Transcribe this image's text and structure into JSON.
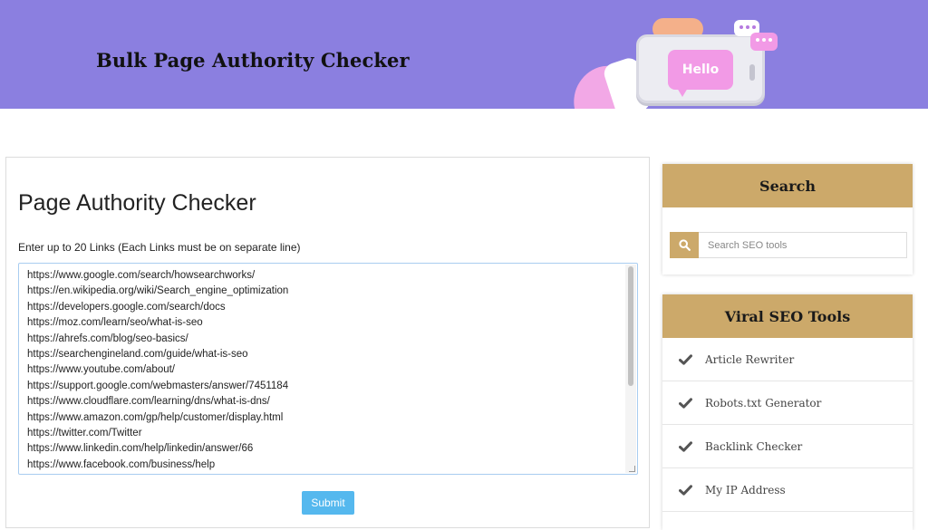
{
  "header": {
    "site_title": "Bulk Page Authority Checker",
    "hero_text": "Hello",
    "bg_color": "#8b7fe0"
  },
  "main": {
    "title": "Page Authority Checker",
    "instructions": "Enter up to 20 Links (Each Links must be on separate line)",
    "links": [
      "https://www.google.com/search/howsearchworks/",
      "https://en.wikipedia.org/wiki/Search_engine_optimization",
      "https://developers.google.com/search/docs",
      "https://moz.com/learn/seo/what-is-seo",
      "https://ahrefs.com/blog/seo-basics/",
      "https://searchengineland.com/guide/what-is-seo",
      "https://www.youtube.com/about/",
      "https://support.google.com/webmasters/answer/7451184",
      "https://www.cloudflare.com/learning/dns/what-is-dns/",
      "https://www.amazon.com/gp/help/customer/display.html",
      "https://twitter.com/Twitter",
      "https://www.linkedin.com/help/linkedin/answer/66",
      "https://www.facebook.com/business/help"
    ],
    "submit_label": "Submit",
    "submit_color": "#55b8ee"
  },
  "sidebar": {
    "accent_color": "#cca96a",
    "search": {
      "title": "Search",
      "placeholder": "Search SEO tools",
      "icon": "search-icon"
    },
    "tools": {
      "title": "Viral SEO Tools",
      "icon": "check-icon",
      "items": [
        {
          "label": "Article Rewriter"
        },
        {
          "label": "Robots.txt Generator"
        },
        {
          "label": "Backlink Checker"
        },
        {
          "label": "My IP Address"
        }
      ]
    }
  }
}
